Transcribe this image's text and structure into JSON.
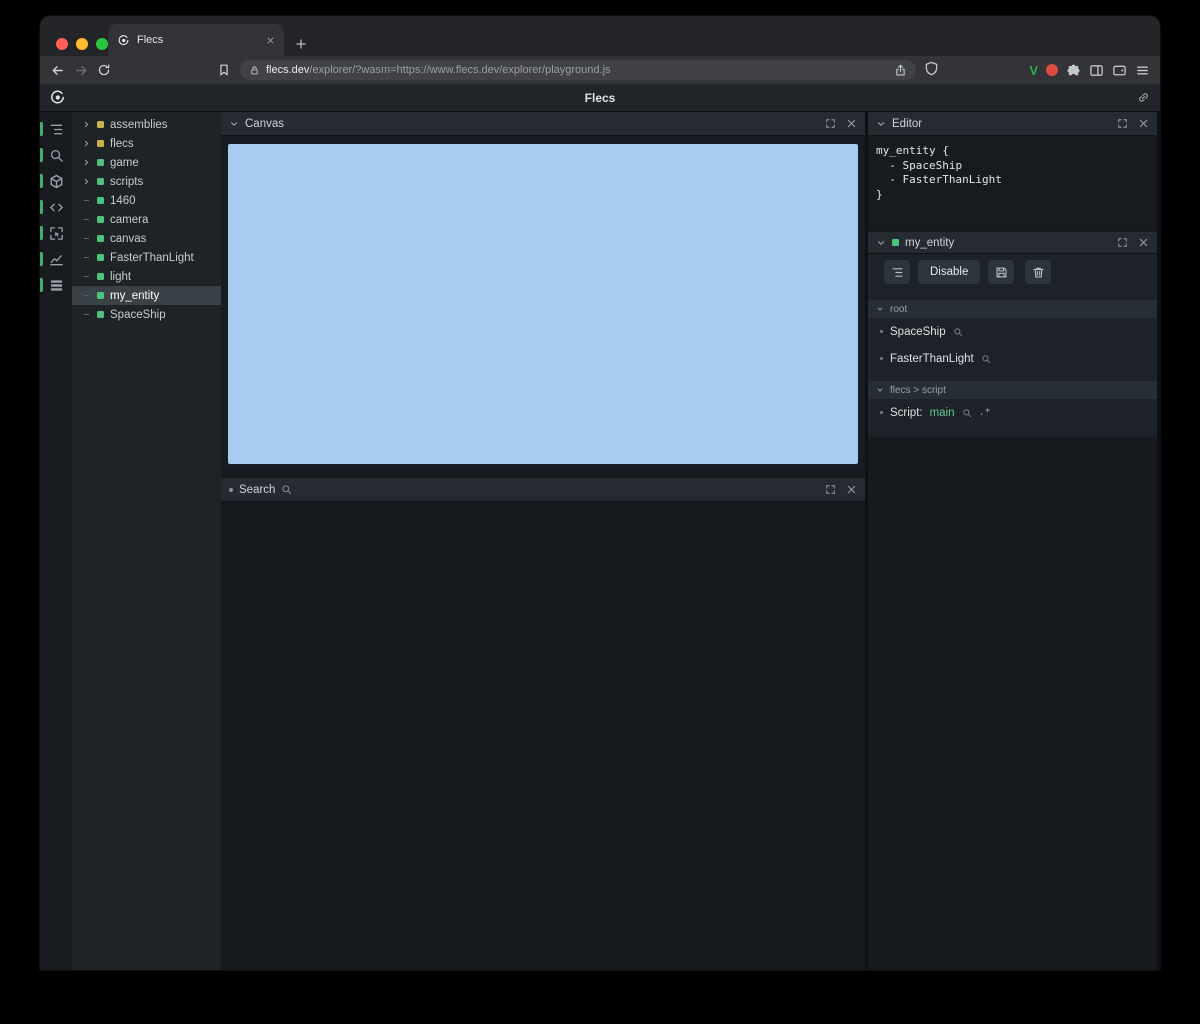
{
  "browser": {
    "tab": {
      "title": "Flecs"
    },
    "url": {
      "domain": "flecs.dev",
      "path": "/explorer/?wasm=https://www.flecs.dev/explorer/playground.js"
    }
  },
  "app_header": {
    "title": "Flecs"
  },
  "sidebar": {
    "tools": [
      {
        "name": "tree-view"
      },
      {
        "name": "query-search"
      },
      {
        "name": "entities"
      },
      {
        "name": "code-editor"
      },
      {
        "name": "inspector"
      },
      {
        "name": "statistics"
      },
      {
        "name": "tables"
      }
    ]
  },
  "tree": {
    "items": [
      {
        "label": "assemblies",
        "color": "yellow",
        "expandable": true
      },
      {
        "label": "flecs",
        "color": "yellow",
        "expandable": true
      },
      {
        "label": "game",
        "color": "green",
        "expandable": true
      },
      {
        "label": "scripts",
        "color": "green",
        "expandable": true
      },
      {
        "label": "1460",
        "color": "green",
        "expandable": false
      },
      {
        "label": "camera",
        "color": "green",
        "expandable": false
      },
      {
        "label": "canvas",
        "color": "green",
        "expandable": false
      },
      {
        "label": "FasterThanLight",
        "color": "green",
        "expandable": false
      },
      {
        "label": "light",
        "color": "green",
        "expandable": false
      },
      {
        "label": "my_entity",
        "color": "green",
        "expandable": false,
        "selected": true
      },
      {
        "label": "SpaceShip",
        "color": "green",
        "expandable": false
      }
    ]
  },
  "panels": {
    "canvas": {
      "title": "Canvas"
    },
    "search": {
      "title": "Search"
    },
    "editor": {
      "title": "Editor",
      "code_lines": [
        "my_entity {",
        "  - SpaceShip",
        "  - FasterThanLight",
        "}"
      ]
    },
    "inspector": {
      "title": "my_entity",
      "toolbar": {
        "disable_label": "Disable"
      },
      "sections": [
        {
          "title": "root",
          "items": [
            {
              "label": "SpaceShip"
            },
            {
              "label": "FasterThanLight"
            }
          ]
        },
        {
          "title": "flecs > script",
          "items": [
            {
              "label": "Script:",
              "value": "main",
              "suffix": ".*"
            }
          ]
        }
      ]
    }
  },
  "icons": {
    "back-icon": "arrow-left",
    "forward-icon": "arrow-right",
    "reload-icon": "circular-arrow",
    "bookmark-icon": "bookmark-flag",
    "lock-icon": "padlock",
    "share-icon": "box-arrow-up",
    "shield-icon": "shield",
    "violentmonkey-icon": "letter-V-green",
    "extension-dot-icon": "red-circle",
    "extensions-icon": "puzzle-piece",
    "sidebar-toggle-icon": "split-rectangle",
    "wallet-icon": "wallet-card",
    "menu-icon": "hamburger-lines",
    "flecs-logo": "circular-swirl",
    "link-icon": "chain-link",
    "tree-view-icon": "indented-list",
    "search-icon": "magnifier",
    "entities-icon": "cube",
    "code-icon": "angle-brackets",
    "inspector-icon": "cursor-in-corners",
    "statistics-icon": "line-chart",
    "tables-icon": "stacked-rows",
    "chevron-down-icon": "chevron-down",
    "chevron-right-icon": "chevron-right",
    "expand-icon": "corner-brackets",
    "close-icon": "x-cross",
    "save-icon": "floppy-disk",
    "delete-icon": "trash-can",
    "script-suffix-icon": "dot-asterisk"
  },
  "colors": {
    "accent_green": "#4dc27b",
    "accent_yellow": "#c9b44c",
    "canvas_blue": "#a7ccf0",
    "selected_row": "#3a4147",
    "value_green": "#62ca90",
    "traffic_red": "#ff5f57",
    "traffic_yellow": "#febc2e",
    "traffic_green": "#29c73f"
  }
}
